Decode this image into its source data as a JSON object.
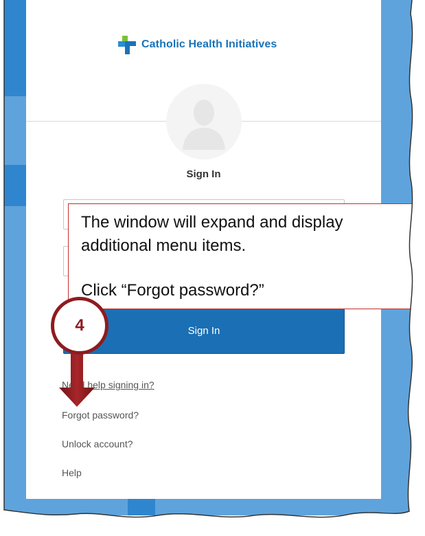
{
  "brand": {
    "name": "Catholic Health Initiatives",
    "color": "#1a73b8"
  },
  "form": {
    "title": "Sign In",
    "username_value": "",
    "password_value": "",
    "submit_label": "Sign In",
    "submit_color": "#1b6fb4"
  },
  "links": {
    "need_help": "Need help signing in?",
    "forgot": "Forgot password?",
    "unlock": "Unlock account?",
    "help": "Help"
  },
  "callout": {
    "line1": "The window will expand and display",
    "line2": "additional menu items.",
    "line3": "Click “Forgot password?”",
    "border_color": "#c0302f"
  },
  "step": {
    "number": "4",
    "color": "#8e1b1f"
  },
  "icons": {
    "logo": "cross-logo-icon",
    "avatar": "user-silhouette-icon",
    "arrow": "down-arrow-icon"
  }
}
